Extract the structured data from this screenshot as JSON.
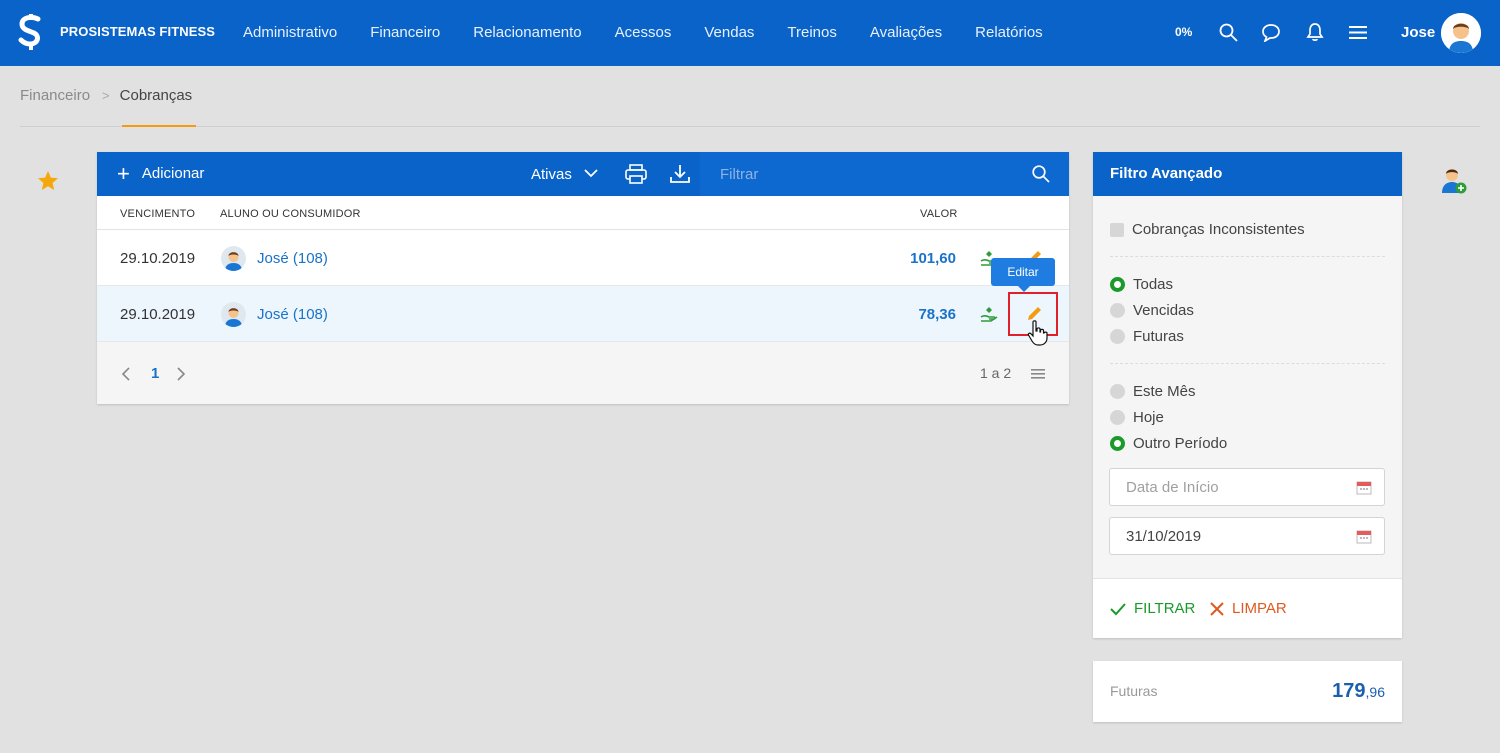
{
  "header": {
    "brand": "PROSISTEMAS FITNESS",
    "nav": [
      "Administrativo",
      "Financeiro",
      "Relacionamento",
      "Acessos",
      "Vendas",
      "Treinos",
      "Avaliações",
      "Relatórios"
    ],
    "progress": "0%",
    "user_name": "Jose"
  },
  "breadcrumb": {
    "parent": "Financeiro",
    "separator": ">",
    "current": "Cobranças"
  },
  "toolbar": {
    "add_label": "Adicionar",
    "status_filter": "Ativas",
    "filter_placeholder": "Filtrar"
  },
  "table": {
    "columns": [
      "VENCIMENTO",
      "ALUNO OU CONSUMIDOR",
      "VALOR"
    ],
    "rows": [
      {
        "vencimento": "29.10.2019",
        "aluno": "José (108)",
        "valor": "101,60"
      },
      {
        "vencimento": "29.10.2019",
        "aluno": "José (108)",
        "valor": "78,36"
      }
    ],
    "tooltip": "Editar"
  },
  "pagination": {
    "current_page": "1",
    "count": "1 a 2"
  },
  "advanced_filter": {
    "title": "Filtro Avançado",
    "checkbox_label": "Cobranças Inconsistentes",
    "status_options": [
      "Todas",
      "Vencidas",
      "Futuras"
    ],
    "status_selected": "Todas",
    "period_options": [
      "Este Mês",
      "Hoje",
      "Outro Período"
    ],
    "period_selected": "Outro Período",
    "start_date_placeholder": "Data de Início",
    "end_date_value": "31/10/2019",
    "filter_button": "FILTRAR",
    "clear_button": "LIMPAR"
  },
  "summary": {
    "label": "Futuras",
    "value_int": "179",
    "value_dec": ",96"
  },
  "colors": {
    "primary": "#0a63c9",
    "accent": "#f39c12",
    "success": "#1a9a2a",
    "danger": "#e05a20",
    "link": "#1a73c8"
  }
}
